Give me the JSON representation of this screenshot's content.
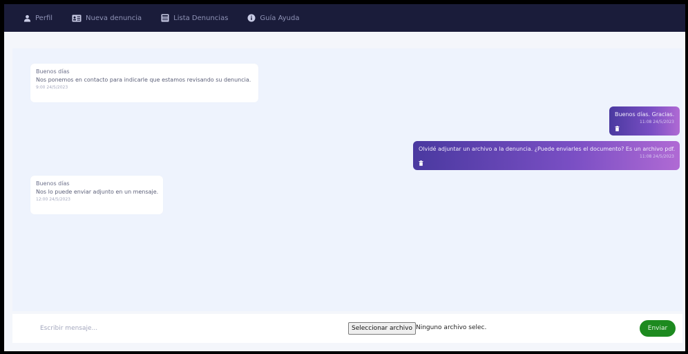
{
  "nav": {
    "items": [
      {
        "label": "Perfil",
        "icon": "user-icon"
      },
      {
        "label": "Nueva denuncia",
        "icon": "id-card-icon"
      },
      {
        "label": "Lista Denuncias",
        "icon": "list-window-icon"
      },
      {
        "label": "Guía Ayuda",
        "icon": "info-icon"
      }
    ]
  },
  "messages": {
    "m1": {
      "line1": "Buenos días",
      "line2": "Nos ponemos en contacto para indicarle que estamos revisando su denuncia.",
      "time": "9:00 24/5/2023"
    },
    "m2": {
      "text": "Buenos días. Gracias.",
      "time": "11:08 24/5/2023"
    },
    "m3": {
      "text": "Olvidé adjuntar un archivo a la denuncia. ¿Puede enviarles el documento? Es un archivo pdf.",
      "time": "11:08 24/5/2023"
    },
    "m4": {
      "line1": "Buenos días",
      "line2": "Nos lo puede enviar adjunto en un mensaje.",
      "time": "12:00 24/5/2023"
    }
  },
  "compose": {
    "placeholder": "Escribir mensaje...",
    "file_button": "Seleccionar archivo",
    "file_status": "Ninguno archivo selec.",
    "send_label": "Enviar"
  },
  "colors": {
    "navbar": "#1a1c3a",
    "chat_background": "#eef3fd",
    "sent_gradient_start": "#4a39a0",
    "sent_gradient_end": "#b06ad4",
    "send_button": "#1d8a1f"
  }
}
